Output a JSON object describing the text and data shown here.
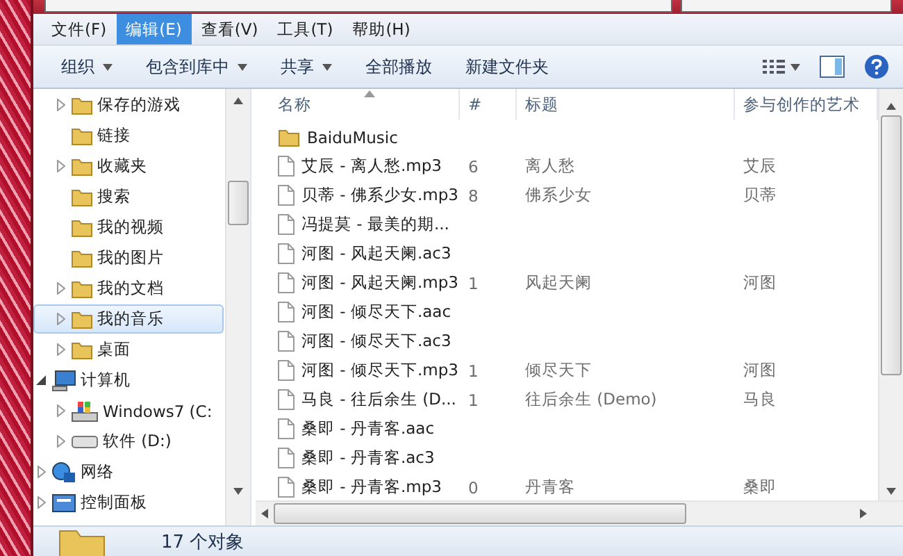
{
  "menu": [
    {
      "label": "文件(F)",
      "selected": false
    },
    {
      "label": "编辑(E)",
      "selected": true
    },
    {
      "label": "查看(V)",
      "selected": false
    },
    {
      "label": "工具(T)",
      "selected": false
    },
    {
      "label": "帮助(H)",
      "selected": false
    }
  ],
  "toolbar": [
    {
      "label": "组织",
      "dropdown": true
    },
    {
      "label": "包含到库中",
      "dropdown": true
    },
    {
      "label": "共享",
      "dropdown": true
    },
    {
      "label": "全部播放",
      "dropdown": false
    },
    {
      "label": "新建文件夹",
      "dropdown": false
    }
  ],
  "nav": {
    "folders": [
      {
        "label": "保存的游戏",
        "expandable": true,
        "selected": false
      },
      {
        "label": "链接",
        "expandable": false,
        "selected": false
      },
      {
        "label": "收藏夹",
        "expandable": true,
        "selected": false
      },
      {
        "label": "搜索",
        "expandable": false,
        "selected": false
      },
      {
        "label": "我的视频",
        "expandable": false,
        "selected": false
      },
      {
        "label": "我的图片",
        "expandable": false,
        "selected": false
      },
      {
        "label": "我的文档",
        "expandable": true,
        "selected": false
      },
      {
        "label": "我的音乐",
        "expandable": true,
        "selected": true
      },
      {
        "label": "桌面",
        "expandable": true,
        "selected": false
      }
    ],
    "roots": [
      {
        "label": "计算机",
        "kind": "computer",
        "expanded": true,
        "children": [
          {
            "label": "Windows7 (C:",
            "kind": "system-drive"
          },
          {
            "label": "软件 (D:)",
            "kind": "drive"
          }
        ]
      },
      {
        "label": "网络",
        "kind": "network",
        "expanded": false
      },
      {
        "label": "控制面板",
        "kind": "panel",
        "expanded": false
      }
    ]
  },
  "table": {
    "columns": [
      "名称",
      "#",
      "标题",
      "参与创作的艺术"
    ],
    "rows": [
      {
        "kind": "folder",
        "name": "BaiduMusic",
        "number": "",
        "title": "",
        "artist": ""
      },
      {
        "kind": "file",
        "name": "艾辰 - 离人愁.mp3",
        "number": "6",
        "title": "离人愁",
        "artist": "艾辰"
      },
      {
        "kind": "file",
        "name": "贝蒂 - 佛系少女.mp3",
        "number": "8",
        "title": "佛系少女",
        "artist": "贝蒂"
      },
      {
        "kind": "file",
        "name": "冯提莫 - 最美的期...",
        "number": "",
        "title": "",
        "artist": ""
      },
      {
        "kind": "file",
        "name": "河图 - 风起天阑.ac3",
        "number": "",
        "title": "",
        "artist": ""
      },
      {
        "kind": "file",
        "name": "河图 - 风起天阑.mp3",
        "number": "1",
        "title": "风起天阑",
        "artist": "河图"
      },
      {
        "kind": "file",
        "name": "河图 - 倾尽天下.aac",
        "number": "",
        "title": "",
        "artist": ""
      },
      {
        "kind": "file",
        "name": "河图 - 倾尽天下.ac3",
        "number": "",
        "title": "",
        "artist": ""
      },
      {
        "kind": "file",
        "name": "河图 - 倾尽天下.mp3",
        "number": "1",
        "title": "倾尽天下",
        "artist": "河图"
      },
      {
        "kind": "file",
        "name": "马良 - 往后余生 (D...",
        "number": "1",
        "title": "往后余生 (Demo)",
        "artist": "马良"
      },
      {
        "kind": "file",
        "name": "桑即 - 丹青客.aac",
        "number": "",
        "title": "",
        "artist": ""
      },
      {
        "kind": "file",
        "name": "桑即 - 丹青客.ac3",
        "number": "",
        "title": "",
        "artist": ""
      },
      {
        "kind": "file",
        "name": "桑即 - 丹青客.mp3",
        "number": "0",
        "title": "丹青客",
        "artist": "桑即"
      }
    ]
  },
  "status_bar": {
    "count": "17 个对象"
  }
}
